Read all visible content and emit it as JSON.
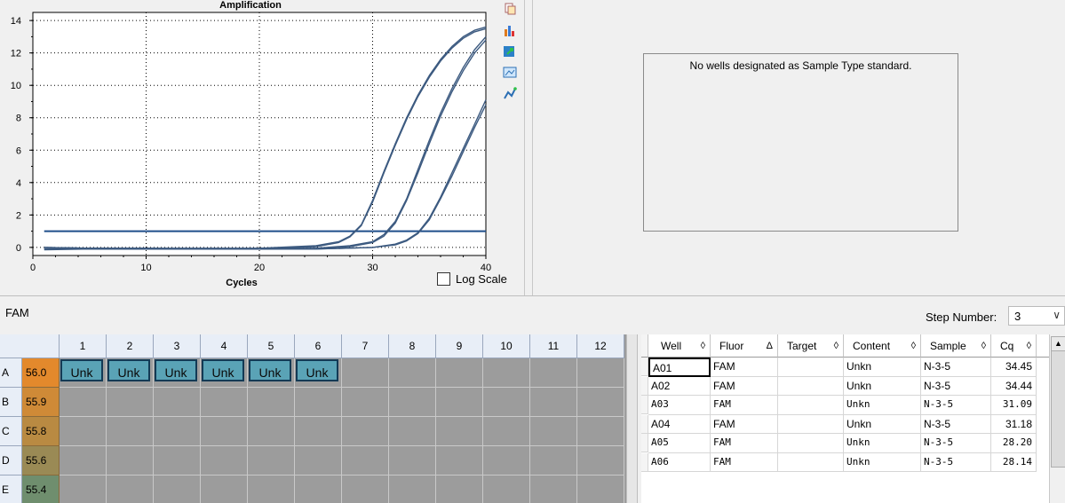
{
  "chart_data": {
    "type": "line",
    "title": "Amplification",
    "xlabel": "Cycles",
    "ylabel": "",
    "xlim": [
      0,
      40
    ],
    "ylim": [
      -0.5,
      14.5
    ],
    "xticks": [
      0,
      10,
      20,
      30,
      40
    ],
    "yticks": [
      0,
      2,
      4,
      6,
      8,
      10,
      12,
      14
    ],
    "grid": true,
    "threshold": 1.0,
    "series": [
      {
        "curve": "A05",
        "x": [
          1,
          5,
          10,
          15,
          20,
          25,
          27,
          28,
          29,
          30,
          31,
          32,
          33,
          34,
          35,
          36,
          37,
          38,
          39,
          40
        ],
        "y": [
          0,
          -0.05,
          -0.05,
          -0.05,
          -0.05,
          0.1,
          0.35,
          0.7,
          1.4,
          2.9,
          4.7,
          6.4,
          8.0,
          9.4,
          10.6,
          11.6,
          12.4,
          13.0,
          13.4,
          13.6
        ]
      },
      {
        "curve": "A06",
        "x": [
          1,
          5,
          10,
          15,
          20,
          25,
          27,
          28,
          29,
          30,
          31,
          32,
          33,
          34,
          35,
          36,
          37,
          38,
          39,
          40
        ],
        "y": [
          -0.1,
          -0.1,
          -0.1,
          -0.1,
          -0.1,
          0.05,
          0.3,
          0.65,
          1.35,
          2.8,
          4.6,
          6.3,
          7.9,
          9.3,
          10.5,
          11.5,
          12.3,
          12.9,
          13.3,
          13.5
        ]
      },
      {
        "curve": "A03",
        "x": [
          1,
          5,
          10,
          15,
          20,
          25,
          28,
          30,
          31,
          32,
          33,
          34,
          35,
          36,
          37,
          38,
          39,
          40
        ],
        "y": [
          0,
          -0.05,
          -0.05,
          -0.1,
          -0.1,
          -0.05,
          0.1,
          0.35,
          0.8,
          1.6,
          3.0,
          4.8,
          6.6,
          8.3,
          9.8,
          11.1,
          12.2,
          13.0
        ]
      },
      {
        "curve": "A04",
        "x": [
          1,
          5,
          10,
          15,
          20,
          25,
          28,
          30,
          31,
          32,
          33,
          34,
          35,
          36,
          37,
          38,
          39,
          40
        ],
        "y": [
          -0.15,
          -0.1,
          -0.1,
          -0.1,
          -0.1,
          -0.05,
          0.05,
          0.3,
          0.7,
          1.5,
          2.9,
          4.6,
          6.4,
          8.1,
          9.6,
          10.9,
          12.0,
          12.8
        ]
      },
      {
        "curve": "A01",
        "x": [
          1,
          5,
          10,
          15,
          20,
          25,
          30,
          32,
          33,
          34,
          35,
          36,
          37,
          38,
          39,
          40
        ],
        "y": [
          -0.1,
          -0.1,
          -0.1,
          -0.1,
          -0.1,
          -0.1,
          0,
          0.2,
          0.45,
          0.9,
          1.8,
          3.1,
          4.6,
          6.1,
          7.6,
          9.1
        ]
      },
      {
        "curve": "A02",
        "x": [
          1,
          5,
          10,
          15,
          20,
          25,
          30,
          32,
          33,
          34,
          35,
          36,
          37,
          38,
          39,
          40
        ],
        "y": [
          0,
          -0.05,
          -0.1,
          -0.1,
          -0.1,
          -0.1,
          0,
          0.15,
          0.4,
          0.85,
          1.7,
          3.0,
          4.4,
          5.9,
          7.4,
          8.8
        ]
      }
    ]
  },
  "log_scale": {
    "label": "Log Scale",
    "checked": false
  },
  "standard_curve": {
    "message": "No wells designated as Sample Type standard."
  },
  "fluor_bar": {
    "fluor": "FAM",
    "step_label": "Step Number:",
    "step_value": "3"
  },
  "plate": {
    "columns": [
      "1",
      "2",
      "3",
      "4",
      "5",
      "6",
      "7",
      "8",
      "9",
      "10",
      "11",
      "12"
    ],
    "rows": [
      {
        "label": "A",
        "temp": "56.0",
        "temp_color": "#e3892c",
        "wells": [
          "Unk",
          "Unk",
          "Unk",
          "Unk",
          "Unk",
          "Unk",
          "",
          "",
          "",
          "",
          "",
          ""
        ]
      },
      {
        "label": "B",
        "temp": "55.9",
        "temp_color": "#cf8a37",
        "wells": [
          "",
          "",
          "",
          "",
          "",
          "",
          "",
          "",
          "",
          "",
          "",
          ""
        ]
      },
      {
        "label": "C",
        "temp": "55.8",
        "temp_color": "#b98a42",
        "wells": [
          "",
          "",
          "",
          "",
          "",
          "",
          "",
          "",
          "",
          "",
          "",
          ""
        ]
      },
      {
        "label": "D",
        "temp": "55.6",
        "temp_color": "#9a8a55",
        "wells": [
          "",
          "",
          "",
          "",
          "",
          "",
          "",
          "",
          "",
          "",
          "",
          ""
        ]
      },
      {
        "label": "E",
        "temp": "55.4",
        "temp_color": "#6f8e6e",
        "wells": [
          "",
          "",
          "",
          "",
          "",
          "",
          "",
          "",
          "",
          "",
          "",
          ""
        ]
      }
    ]
  },
  "well_table": {
    "headers": [
      "Well",
      "Fluor",
      "Target",
      "Content",
      "Sample",
      "Cq"
    ],
    "sort_marks": [
      "◊",
      "Δ",
      "◊",
      "◊",
      "◊",
      "◊"
    ],
    "rows": [
      {
        "well": "A01",
        "fluor": "FAM",
        "target": "",
        "content": "Unkn",
        "sample": "N-3-5",
        "cq": "34.45"
      },
      {
        "well": "A02",
        "fluor": "FAM",
        "target": "",
        "content": "Unkn",
        "sample": "N-3-5",
        "cq": "34.44"
      },
      {
        "well": "A03",
        "fluor": "FAM",
        "target": "",
        "content": "Unkn",
        "sample": "N-3-5",
        "cq": "31.09"
      },
      {
        "well": "A04",
        "fluor": "FAM",
        "target": "",
        "content": "Unkn",
        "sample": "N-3-5",
        "cq": "31.18"
      },
      {
        "well": "A05",
        "fluor": "FAM",
        "target": "",
        "content": "Unkn",
        "sample": "N-3-5",
        "cq": "28.20"
      },
      {
        "well": "A06",
        "fluor": "FAM",
        "target": "",
        "content": "Unkn",
        "sample": "N-3-5",
        "cq": "28.14"
      }
    ]
  },
  "toolbar_icons": [
    "copy-icon",
    "chart-settings-icon",
    "export-icon",
    "image-icon",
    "graph-icon"
  ],
  "colors": {
    "curve": "#3c5a80",
    "threshold": "#1f4e8a",
    "well_unk": "#5aa3b6"
  }
}
